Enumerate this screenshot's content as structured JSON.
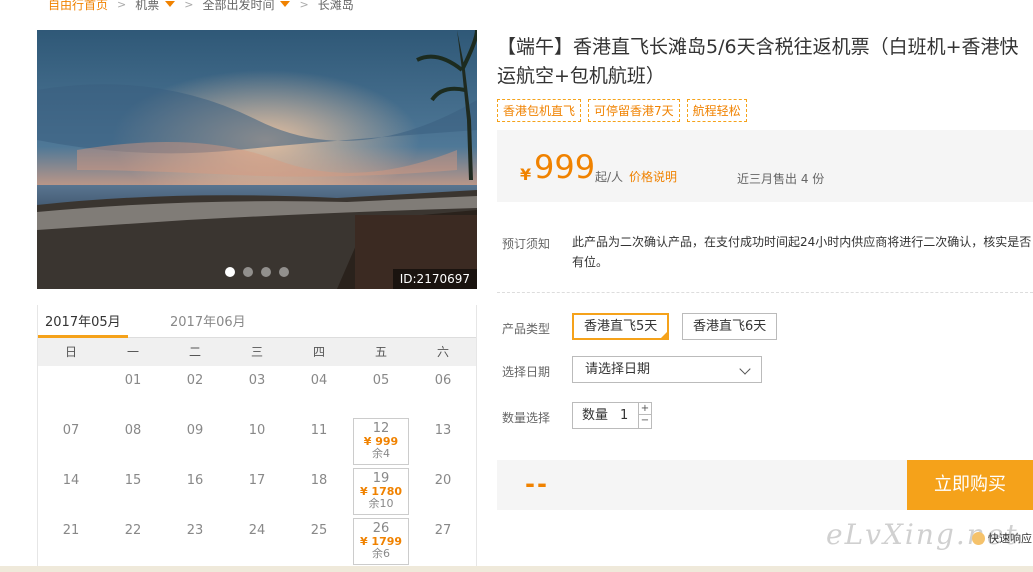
{
  "breadcrumb": {
    "home": "自由行首页",
    "item1": "机票",
    "item2": "全部出发时间",
    "item3": "长滩岛"
  },
  "photo": {
    "id_label": "ID:2170697",
    "slides": 4,
    "active_slide": 1
  },
  "calendar": {
    "tabs": [
      "2017年05月",
      "2017年06月"
    ],
    "weekdays": [
      "日",
      "一",
      "二",
      "三",
      "四",
      "五",
      "六"
    ],
    "rows": [
      [
        {
          "d": ""
        },
        {
          "d": "01"
        },
        {
          "d": "02"
        },
        {
          "d": "03"
        },
        {
          "d": "04"
        },
        {
          "d": "05"
        },
        {
          "d": "06"
        }
      ],
      [
        {
          "d": "07"
        },
        {
          "d": "08"
        },
        {
          "d": "09"
        },
        {
          "d": "10"
        },
        {
          "d": "11"
        },
        {
          "d": "12",
          "price": "¥ 999",
          "rem": "余4"
        },
        {
          "d": "13"
        }
      ],
      [
        {
          "d": "14"
        },
        {
          "d": "15"
        },
        {
          "d": "16"
        },
        {
          "d": "17"
        },
        {
          "d": "18"
        },
        {
          "d": "19",
          "price": "¥ 1780",
          "rem": "余10"
        },
        {
          "d": "20"
        }
      ],
      [
        {
          "d": "21"
        },
        {
          "d": "22"
        },
        {
          "d": "23"
        },
        {
          "d": "24"
        },
        {
          "d": "25"
        },
        {
          "d": "26",
          "price": "¥ 1799",
          "rem": "余6"
        },
        {
          "d": "27"
        }
      ]
    ]
  },
  "product": {
    "title": "【端午】香港直飞长滩岛5/6天含税往返机票（白班机+香港快运航空+包机航班）",
    "tags": [
      "香港包机直飞",
      "可停留香港7天",
      "航程轻松"
    ],
    "yen": "¥",
    "price": "999",
    "per": "起/人",
    "price_note": "价格说明",
    "sold": "近三月售出 4 份"
  },
  "booking": {
    "notice_label": "预订须知",
    "notice_text": "此产品为二次确认产品，在支付成功时间起24小时内供应商将进行二次确认，核实是否有位。",
    "type_label": "产品类型",
    "types": [
      "香港直飞5天",
      "香港直飞6天"
    ],
    "date_label": "选择日期",
    "date_placeholder": "请选择日期",
    "qty_label": "数量选择",
    "qty_prefix": "数量",
    "qty_value": "1",
    "qty_plus": "+",
    "qty_minus": "−",
    "total": "--",
    "buy": "立即购买"
  },
  "footer": {
    "quick": "快速响应",
    "watermark": "eLvXing.net"
  }
}
